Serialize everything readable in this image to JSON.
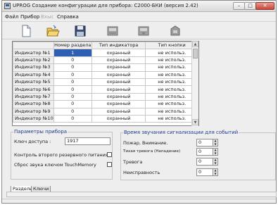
{
  "window": {
    "title": "UPROG  Создание конфигурации для прибора: С2000-БКИ (версия  2.42)",
    "min_glyph": "–",
    "max_glyph": "□",
    "close_glyph": "✕"
  },
  "menu": {
    "items": [
      {
        "label": "Файл",
        "disabled": false
      },
      {
        "label": "Прибор",
        "disabled": false
      },
      {
        "label": "Вхыс",
        "disabled": true
      },
      {
        "label": "Справка",
        "disabled": false
      }
    ]
  },
  "toolbar": {
    "buttons": [
      {
        "icon": "new-document-icon"
      },
      {
        "icon": "open-folder-icon"
      },
      {
        "icon": "save-disk-icon"
      },
      {
        "icon": "read-from-device-icon"
      },
      {
        "icon": "write-to-device-icon"
      },
      {
        "icon": "device-icon"
      }
    ]
  },
  "grid": {
    "columns": [
      "",
      "Номер раздела",
      "Тип индикатора",
      "Тип кнопки"
    ],
    "rows": [
      {
        "name": "Индикатор №1",
        "section": "1",
        "indicator_type": "охранный",
        "button_type": "не использ."
      },
      {
        "name": "Индикатор №2",
        "section": "0",
        "indicator_type": "охранный",
        "button_type": "не использ."
      },
      {
        "name": "Индикатор №3",
        "section": "0",
        "indicator_type": "охранный",
        "button_type": "не использ."
      },
      {
        "name": "Индикатор №4",
        "section": "0",
        "indicator_type": "охранный",
        "button_type": "не использ."
      },
      {
        "name": "Индикатор №5",
        "section": "0",
        "indicator_type": "охранный",
        "button_type": "не использ."
      },
      {
        "name": "Индикатор №6",
        "section": "0",
        "indicator_type": "охранный",
        "button_type": "не использ."
      },
      {
        "name": "Индикатор №7",
        "section": "0",
        "indicator_type": "охранный",
        "button_type": "не использ."
      },
      {
        "name": "Индикатор №8",
        "section": "0",
        "indicator_type": "охранный",
        "button_type": "не использ."
      },
      {
        "name": "Индикатор №9",
        "section": "0",
        "indicator_type": "охранный",
        "button_type": "не использ."
      },
      {
        "name": "Индикатор №10",
        "section": "0",
        "indicator_type": "охранный",
        "button_type": "не использ."
      }
    ],
    "selected_color": "#2f5fb3"
  },
  "params": {
    "legend": "Параметры прибора",
    "access_key_label": "Ключ доступа :",
    "access_key_value": "1917",
    "backup_power_label": "Контроль второго резервного питания",
    "backup_power_checked": false,
    "touchmemory_label": "Сброс звука ключом TouchMemory",
    "touchmemory_checked": false
  },
  "sound_time": {
    "legend": "Время звучания сигнализации для событий",
    "fields": [
      {
        "label": "Пожар, Внимание.",
        "value": "0"
      },
      {
        "label": "Тихая тревога (Нападение)",
        "value": "0"
      },
      {
        "label": "Тревога",
        "value": "0"
      },
      {
        "label": "Неисправность",
        "value": "0"
      }
    ]
  },
  "tabs": [
    {
      "label": "Разделы",
      "active": true
    },
    {
      "label": "Ключи",
      "active": false
    }
  ],
  "colors": {
    "accent": "#1f3b8a",
    "window_bg": "#eeeeee"
  }
}
